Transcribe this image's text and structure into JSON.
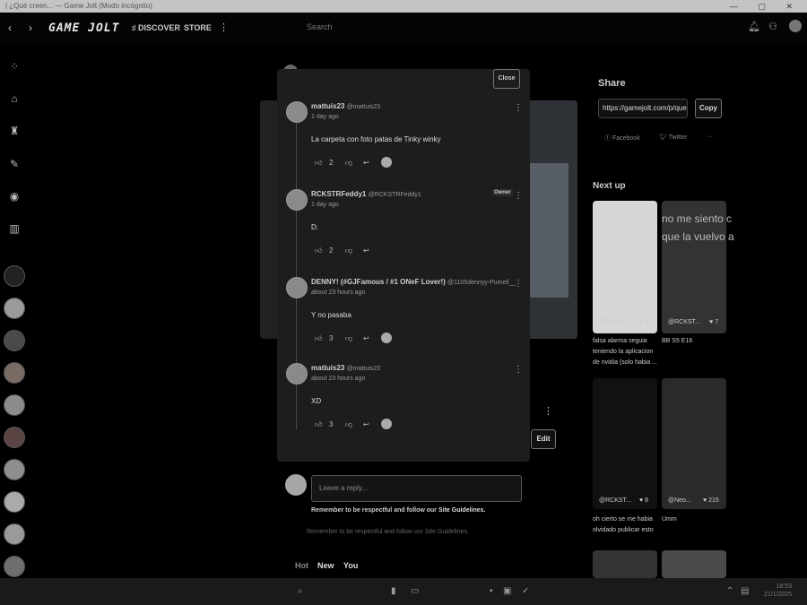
{
  "window": {
    "title": "| ¿Qué creen... — Game Jolt (Modo incógnito)"
  },
  "header": {
    "logo": "GAME JOLT",
    "discover": "DISCOVER",
    "store": "STORE",
    "search_placeholder": "Search"
  },
  "modal": {
    "close_label": "Close",
    "owner_badge": "Owner",
    "comments": [
      {
        "name": "mattuis23",
        "handle": "@mattuis23",
        "time": "1 day ago",
        "body": "La carpeta con foto patas de Tinky winky",
        "likes": "2"
      },
      {
        "name": "RCKSTRFeddy1",
        "handle": "@RCKSTRFeddy1",
        "time": "1 day ago",
        "body": "D:",
        "likes": "2"
      },
      {
        "name": "DENNY! (#GJFamous / #1 ONeF Lover!)",
        "handle": "@1105dennyy-Pumell__",
        "time": "about 23 hours ago",
        "body": "Y no pasaba",
        "likes": "3"
      },
      {
        "name": "mattuis23",
        "handle": "@mattuis23",
        "time": "about 23 hours ago",
        "body": "XD",
        "likes": "3"
      }
    ]
  },
  "reply": {
    "placeholder": "Leave a reply...",
    "guideline_text": "Remember to be respectful and follow our",
    "guideline_link": "Site Guidelines.",
    "guideline_text2": "Remember to be respectful and follow our",
    "guideline_link2": "Site Guidelines."
  },
  "sort_tabs": {
    "hot": "Hot",
    "new": "New",
    "you": "You"
  },
  "edit_label": "Edit",
  "share": {
    "heading": "Share",
    "url": "https://gamejolt.com/p/que-cre",
    "copy_label": "Copy",
    "facebook": "Facebook",
    "twitter": "Twitter",
    "more": "···"
  },
  "next_up": {
    "heading": "Next up",
    "cards": [
      {
        "user": "@RCKST...",
        "likes": "8",
        "caption": "falsa alarma seguia teniendo la aplicacion de nvidia (solo habia ..."
      },
      {
        "user": "@RCKST...",
        "likes": "7",
        "caption": "BB S5 E16"
      },
      {
        "user": "@RCKST...",
        "likes": "8",
        "caption": "oh cierto se me habia olvidado publicar esto"
      },
      {
        "user": "@Neo...",
        "likes": "215",
        "caption": "Umm"
      }
    ],
    "overlay_text": "no me siento c que la vuelvo a"
  },
  "taskbar": {
    "clock_time": "18:53",
    "clock_date": "21/1/2025"
  }
}
